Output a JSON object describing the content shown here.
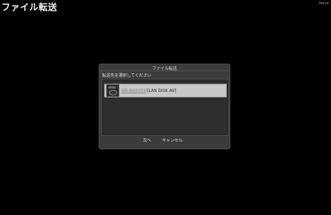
{
  "app": {
    "title": "ファイル転送",
    "about_label": "About"
  },
  "dialog": {
    "title": "ファイル転送",
    "subtitle": "転送先を選択してください",
    "devices": [
      {
        "name": "HN-ANXXXX",
        "type": "[LAN DISK AV]",
        "icon": "nas-drive-icon",
        "selected": true
      }
    ],
    "next_label": "次へ",
    "cancel_label": "キャンセル"
  }
}
